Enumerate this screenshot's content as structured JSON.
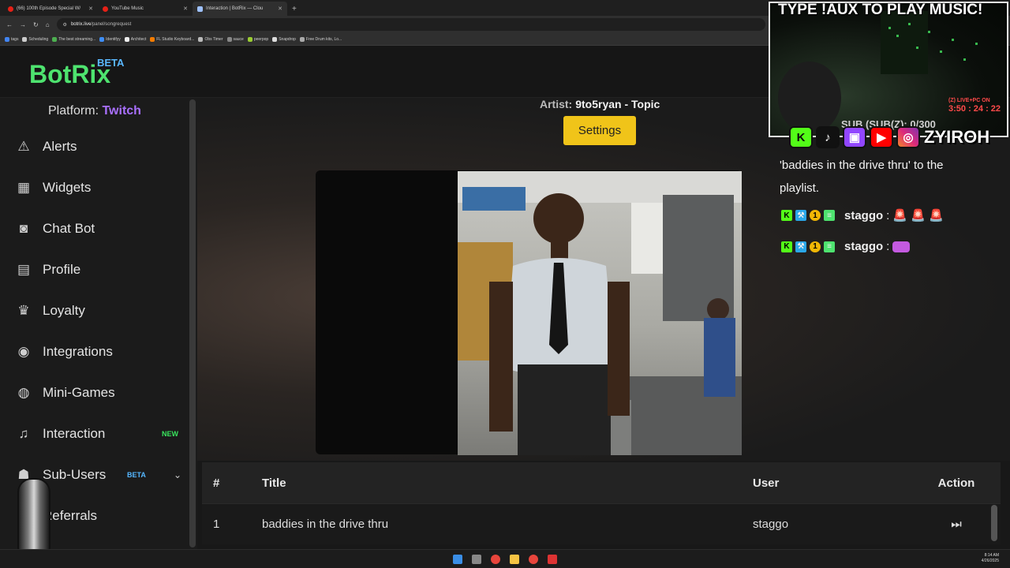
{
  "browser": {
    "tabs": [
      {
        "label": "(66) 100th Episode Special W/"
      },
      {
        "label": "YouTube Music"
      },
      {
        "label": "Interaction | BotRix — Clou"
      }
    ],
    "url_host": "botrix.live",
    "url_path": "/panel/songrequest",
    "bookmarks": [
      "tags",
      "Scheduling",
      "The best streaming...",
      "Identifyy",
      "Architect",
      "FL Studio Keyboard...",
      "Obs Timer",
      "sauce",
      "peerpop",
      "Snapdrop",
      "Free Drum kits, Lo..."
    ]
  },
  "app": {
    "logo": "BotRix",
    "logo_badge": "BETA",
    "platform_label": "Platform:",
    "platform_value": "Twitch"
  },
  "sidebar": {
    "items": [
      {
        "label": "Alerts",
        "icon": "warning-icon"
      },
      {
        "label": "Widgets",
        "icon": "grid-icon"
      },
      {
        "label": "Chat Bot",
        "icon": "robot-icon"
      },
      {
        "label": "Profile",
        "icon": "id-card-icon"
      },
      {
        "label": "Loyalty",
        "icon": "trophy-icon"
      },
      {
        "label": "Integrations",
        "icon": "discord-icon"
      },
      {
        "label": "Mini-Games",
        "icon": "gamepad-icon"
      },
      {
        "label": "Interaction",
        "icon": "music-icon",
        "badge": "NEW"
      },
      {
        "label": "Sub-Users",
        "icon": "users-icon",
        "badge": "BETA"
      },
      {
        "label": "Referrals",
        "icon": "referral-icon"
      }
    ]
  },
  "player": {
    "artist_label": "Artist:",
    "artist_value": "9to5ryan - Topic",
    "settings_label": "Settings"
  },
  "queue": {
    "headers": {
      "num": "#",
      "title": "Title",
      "user": "User",
      "action": "Action"
    },
    "rows": [
      {
        "num": "1",
        "title": "baddies in the drive thru",
        "user": "staggo"
      }
    ]
  },
  "overlay": {
    "banner": "TYPE !AUX TO PLAY MUSIC!",
    "sub_text": "SUB (SUB(Z): 0/300",
    "timer_line1": "(Z) LIVE+PC ON",
    "timer_line2": "3:50 : 24 : 22",
    "channel": "ZYIROH",
    "chat_message": "'baddies in the drive thru' to the playlist.",
    "chat_user": "staggo",
    "chat_sep": ":"
  },
  "taskbar": {
    "time": "8:14 AM",
    "date": "4/26/2025"
  },
  "colors": {
    "logo": "#4ee36f",
    "beta": "#5ab8ff",
    "twitch": "#a970ff",
    "settings_button": "#f0c419"
  }
}
